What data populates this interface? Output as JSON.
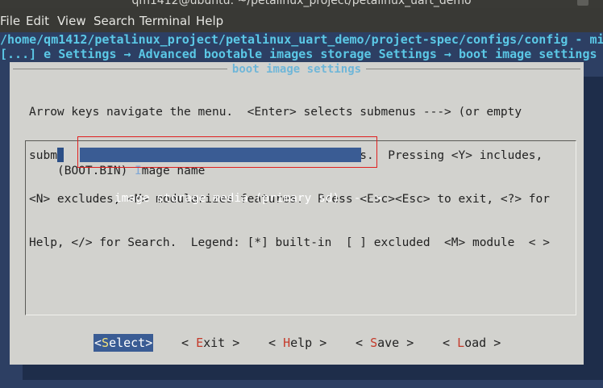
{
  "window": {
    "title": "qm1412@ubuntu: ~/petalinux_project/petalinux_uart_demo"
  },
  "menubar": {
    "items": [
      "File",
      "Edit",
      "View",
      "Search",
      "Terminal",
      "Help"
    ]
  },
  "terminal": {
    "path_line": "/home/qm1412/petalinux_project/petalinux_uart_demo/project-spec/configs/config - mi",
    "breadcrumb_line": "[...] e Settings → Advanced bootable images storage Settings → boot image settings"
  },
  "dialog": {
    "title": "boot image settings",
    "help_lines": [
      "Arrow keys navigate the menu.  <Enter> selects submenus ---> (or empty",
      "submenus ----).  Highlighted letters are hotkeys.  Pressing <Y> includes,",
      "<N> excludes, <M> modularizes features.  Press <Esc><Esc> to exit, <?> for",
      "Help, </> for Search.  Legend: [*] built-in  [ ] excluded  <M> module  < >"
    ],
    "items": [
      {
        "label": "image storage media (primary sd)  --->",
        "selected": true
      },
      {
        "value": "(BOOT.BIN)",
        "hotkey": "I",
        "rest": "mage name",
        "selected": false
      }
    ],
    "buttons": {
      "select": {
        "pre": "<",
        "hk": "S",
        "post": "elect>"
      },
      "exit": {
        "pre": "< ",
        "hk": "E",
        "post": "xit >"
      },
      "help": {
        "pre": "< ",
        "hk": "H",
        "post": "elp >"
      },
      "save": {
        "pre": "< ",
        "hk": "S",
        "post": "ave >"
      },
      "load": {
        "pre": "< ",
        "hk": "L",
        "post": "oad >"
      }
    }
  },
  "colors": {
    "terminal_bg": "#2d3f63",
    "dialog_bg": "#d2d2ce",
    "highlight": "#3a5c94",
    "header_text": "#5bc8e6",
    "callout_border": "#e02020",
    "hotkey_red": "#c43a2a"
  }
}
